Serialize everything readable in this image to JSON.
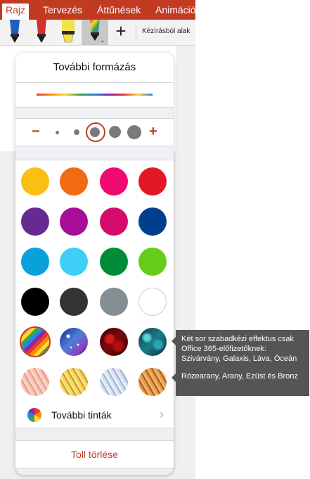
{
  "ribbon": {
    "tabs": [
      {
        "label": "Rajz",
        "active": true
      },
      {
        "label": "Tervezés",
        "active": false
      },
      {
        "label": "Áttűnések",
        "active": false
      },
      {
        "label": "Animációk",
        "active": false
      }
    ],
    "tools": {
      "pens": [
        {
          "icon": "pen-icon",
          "color": "#1f5fbf"
        },
        {
          "icon": "pen-icon",
          "color": "#d32f2f"
        },
        {
          "icon": "highlighter-icon",
          "color": "#f4e04d"
        },
        {
          "icon": "pen-icon",
          "color": "rainbow",
          "selected": true
        }
      ],
      "add_icon": "plus-icon",
      "ink_to_shape_label": "Kézírásból alak"
    },
    "accent_color": "#c33a23"
  },
  "popover": {
    "title": "További formázás",
    "size_selector": {
      "minus": "−",
      "plus": "+",
      "levels": 5,
      "selected_level": 3
    },
    "swatches": [
      {
        "color": "#fbbf13",
        "kind": "solid"
      },
      {
        "color": "#f26b10",
        "kind": "solid"
      },
      {
        "color": "#ee0a6e",
        "kind": "solid"
      },
      {
        "color": "#e41726",
        "kind": "solid"
      },
      {
        "color": "#662b90",
        "kind": "solid"
      },
      {
        "color": "#a70d96",
        "kind": "solid"
      },
      {
        "color": "#d40b6b",
        "kind": "solid"
      },
      {
        "color": "#003f8c",
        "kind": "solid"
      },
      {
        "color": "#0aa0da",
        "kind": "solid"
      },
      {
        "color": "#3dcff5",
        "kind": "solid"
      },
      {
        "color": "#008c37",
        "kind": "solid"
      },
      {
        "color": "#66cc1a",
        "kind": "solid"
      },
      {
        "color": "#000000",
        "kind": "solid"
      },
      {
        "color": "#333333",
        "kind": "solid"
      },
      {
        "color": "#858e93",
        "kind": "solid"
      },
      {
        "color": "#ffffff",
        "kind": "solid"
      },
      {
        "effect": "rainbow",
        "kind": "effect",
        "selected": true
      },
      {
        "effect": "galaxy",
        "kind": "effect"
      },
      {
        "effect": "lava",
        "kind": "effect"
      },
      {
        "effect": "ocean",
        "kind": "effect"
      },
      {
        "effect": "rose-gold",
        "kind": "effect"
      },
      {
        "effect": "gold",
        "kind": "effect"
      },
      {
        "effect": "silver",
        "kind": "effect"
      },
      {
        "effect": "bronze",
        "kind": "effect"
      }
    ],
    "more_inks": {
      "label": "További tinták",
      "icon": "color-wheel-icon",
      "chevron": "›"
    },
    "delete_pen": "Toll törlése"
  },
  "callout": {
    "line1": "Két sor szabadkézi effektus csak",
    "line2": "Office 365-előfizetőknek:",
    "line3": "Szivárvány, Galaxis, Láva, Óceán",
    "line4": "Rózearany, Arany, Ezüst és Bronz"
  }
}
